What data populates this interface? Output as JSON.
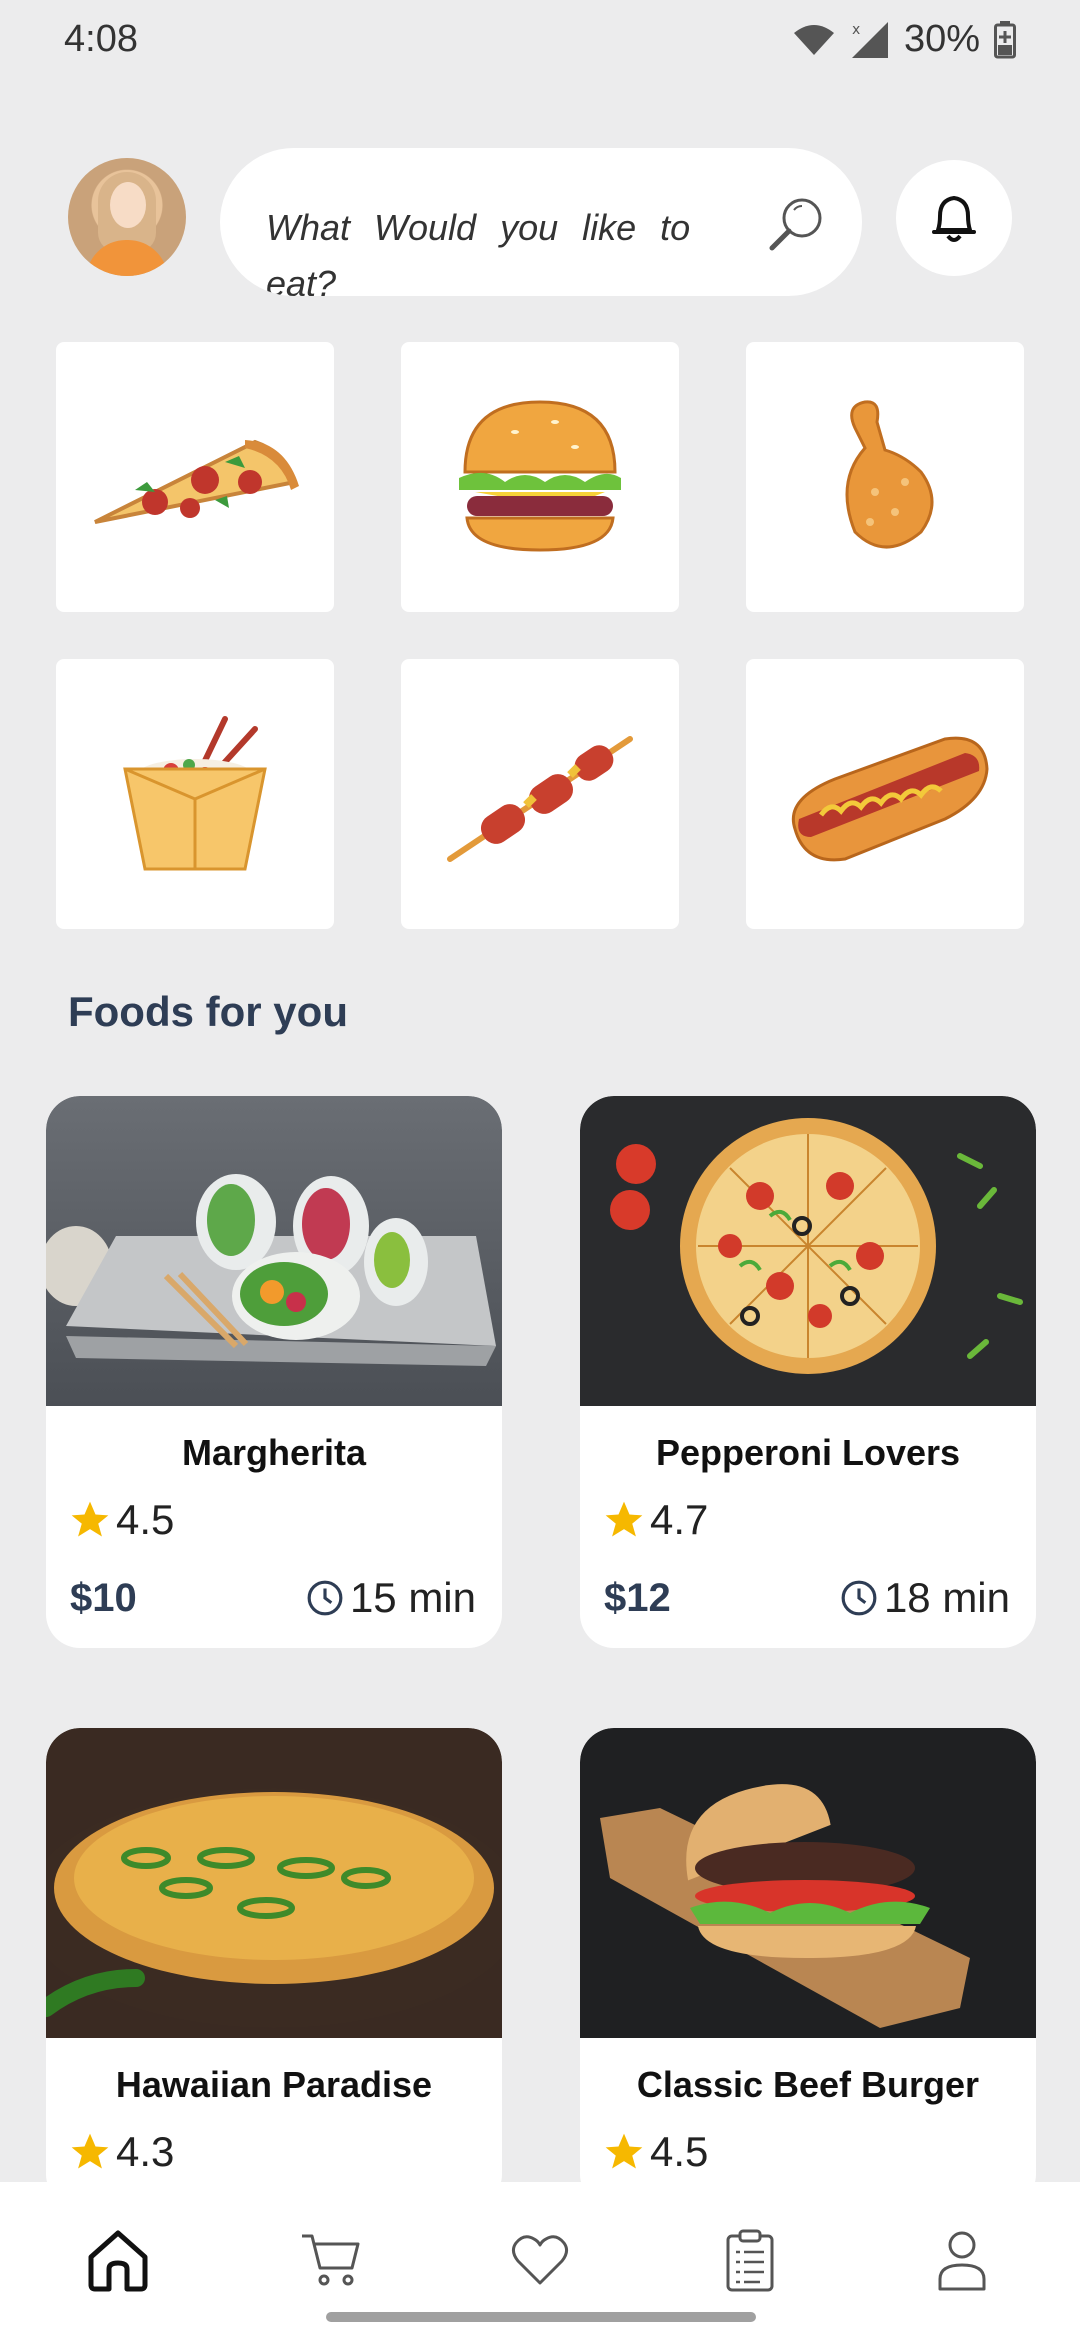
{
  "status_bar": {
    "time": "4:08",
    "battery": "30%"
  },
  "header": {
    "search_placeholder": "What Would you like to eat?"
  },
  "categories": [
    {
      "name": "pizza",
      "icon": "pizza-icon"
    },
    {
      "name": "burger",
      "icon": "burger-icon"
    },
    {
      "name": "chicken",
      "icon": "chicken-leg-icon"
    },
    {
      "name": "noodles",
      "icon": "noodle-box-icon"
    },
    {
      "name": "skewer",
      "icon": "skewer-icon"
    },
    {
      "name": "hotdog",
      "icon": "hotdog-icon"
    }
  ],
  "section_title": "Foods for you",
  "foods": [
    {
      "name": "Margherita",
      "rating": "4.5",
      "price": "$10",
      "time": "15 min"
    },
    {
      "name": "Pepperoni Lovers",
      "rating": "4.7",
      "price": "$12",
      "time": "18 min"
    },
    {
      "name": "Hawaiian Paradise",
      "rating": "4.3",
      "price": "",
      "time": ""
    },
    {
      "name": "Classic Beef Burger",
      "rating": "4.5",
      "price": "",
      "time": ""
    }
  ],
  "bottom_nav": [
    {
      "name": "home",
      "icon": "home-icon",
      "active": true
    },
    {
      "name": "cart",
      "icon": "cart-icon",
      "active": false
    },
    {
      "name": "favorites",
      "icon": "heart-icon",
      "active": false
    },
    {
      "name": "orders",
      "icon": "clipboard-icon",
      "active": false
    },
    {
      "name": "profile",
      "icon": "user-icon",
      "active": false
    }
  ],
  "colors": {
    "accent": "#2e3d55",
    "star": "#f6b800",
    "background": "#ececed"
  }
}
